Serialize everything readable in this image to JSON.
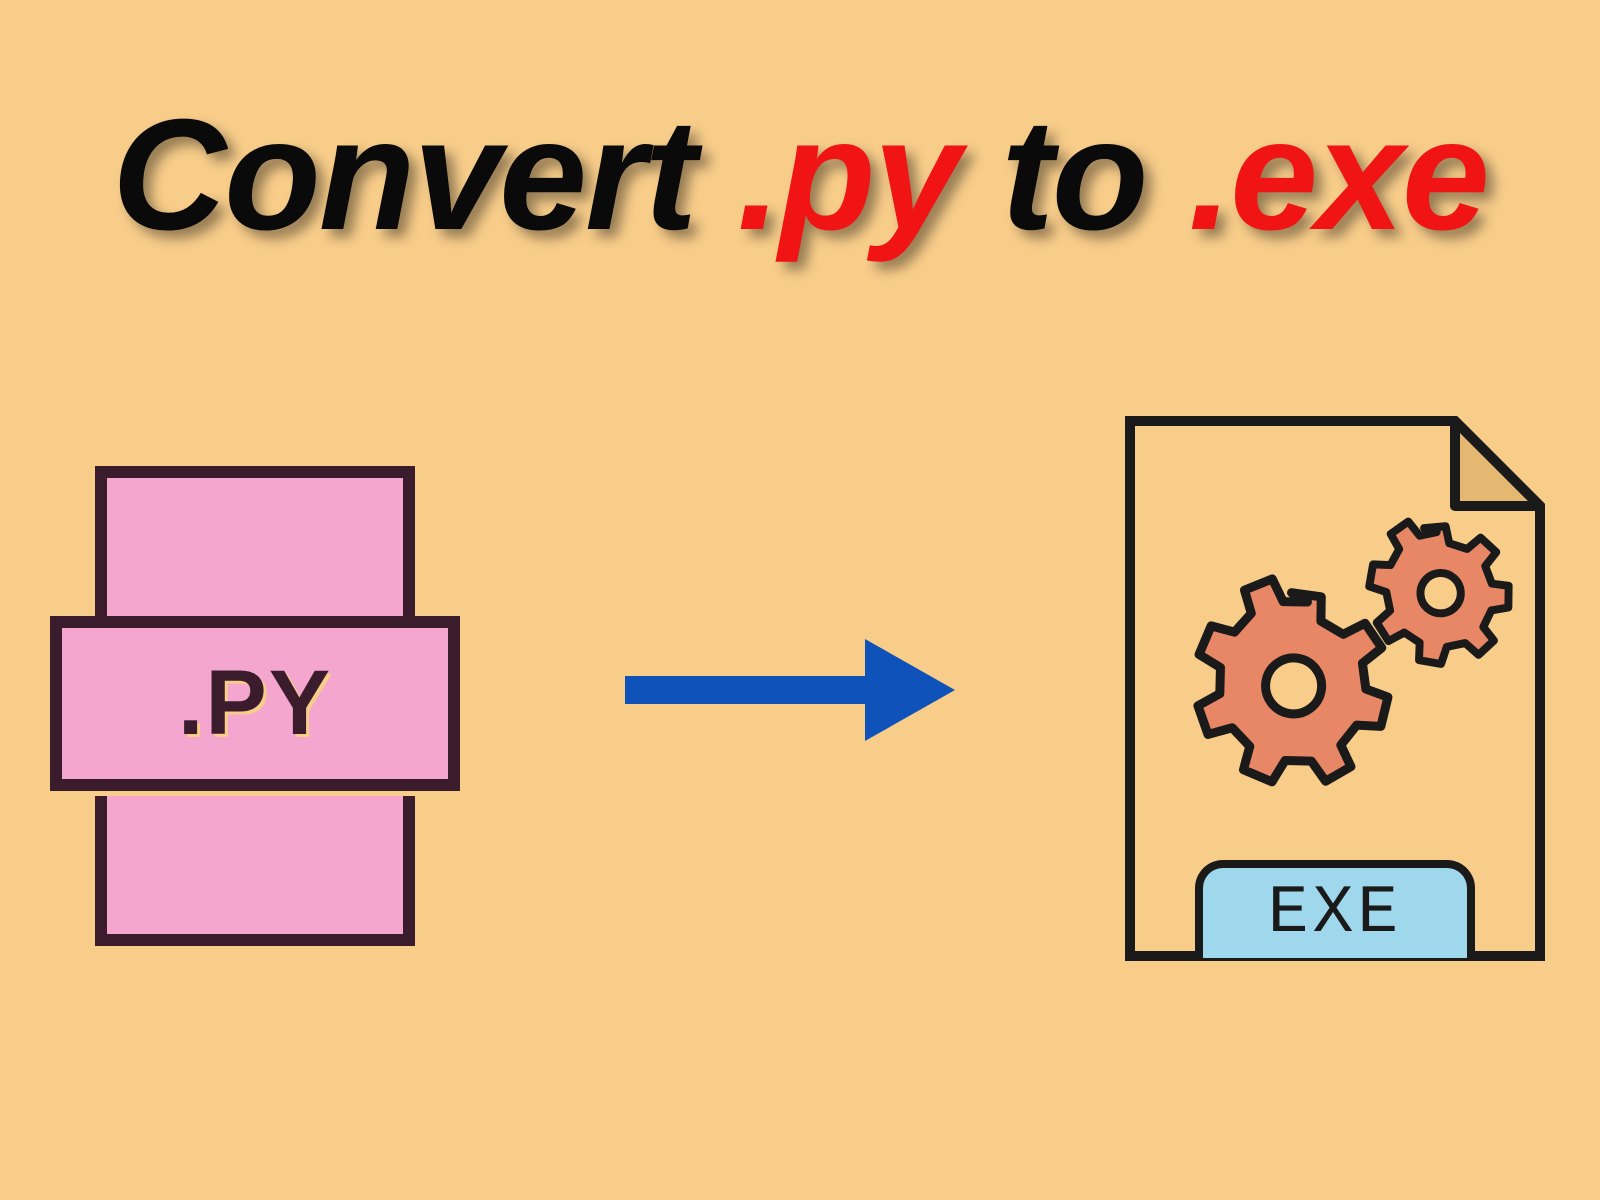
{
  "title": {
    "word1": "Convert",
    "word2": ".py",
    "word3": "to",
    "word4": ".exe"
  },
  "py_icon": {
    "label": ".PY"
  },
  "exe_icon": {
    "label": "EXE"
  },
  "colors": {
    "background": "#f8cd8a",
    "text_black": "#0a0a0a",
    "text_red": "#f01414",
    "py_pink": "#f5a6ce",
    "py_border": "#3b1c2c",
    "arrow_blue": "#0f52ba",
    "exe_blue": "#9fd7ec",
    "exe_border": "#1a1a1a",
    "gear_orange": "#e88765"
  }
}
